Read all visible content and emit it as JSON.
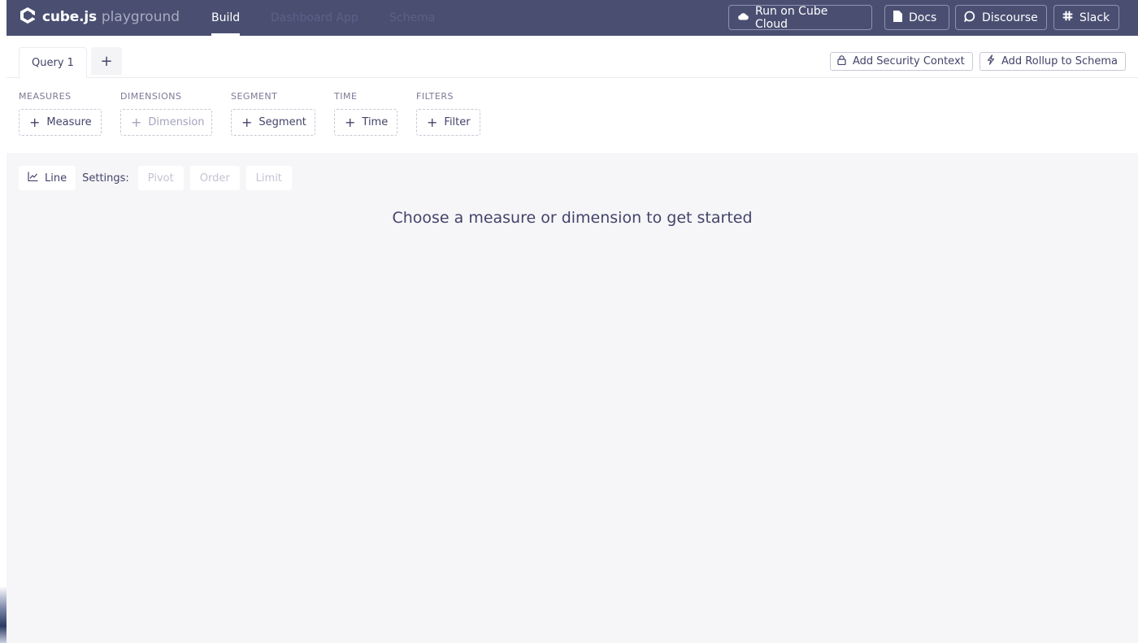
{
  "header": {
    "logo_text": "cube.js",
    "logo_sub": "playground",
    "nav": [
      {
        "label": "Build",
        "active": true
      },
      {
        "label": "Dashboard App",
        "active": false
      },
      {
        "label": "Schema",
        "active": false
      }
    ],
    "buttons": {
      "cloud": "Run on Cube Cloud",
      "docs": "Docs",
      "discourse": "Discourse",
      "slack": "Slack"
    }
  },
  "tabs": {
    "items": [
      {
        "label": "Query 1",
        "active": true
      }
    ],
    "add_label": "+",
    "security_context": "Add Security Context",
    "rollup": "Add Rollup to Schema"
  },
  "members": {
    "measures": {
      "label": "MEASURES",
      "button": "Measure",
      "disabled": false
    },
    "dimensions": {
      "label": "DIMENSIONS",
      "button": "Dimension",
      "disabled": true
    },
    "segment": {
      "label": "SEGMENT",
      "button": "Segment",
      "disabled": false
    },
    "time": {
      "label": "TIME",
      "button": "Time",
      "disabled": false
    },
    "filters": {
      "label": "FILTERS",
      "button": "Filter",
      "disabled": false
    }
  },
  "settings": {
    "chart_type": "Line",
    "label": "Settings:",
    "pivot": "Pivot",
    "order": "Order",
    "limit": "Limit"
  },
  "empty_message": "Choose a measure or dimension to get started",
  "colors": {
    "header_bg": "#4a4f72",
    "content_bg": "#f6f6f8",
    "text": "#43436b"
  }
}
